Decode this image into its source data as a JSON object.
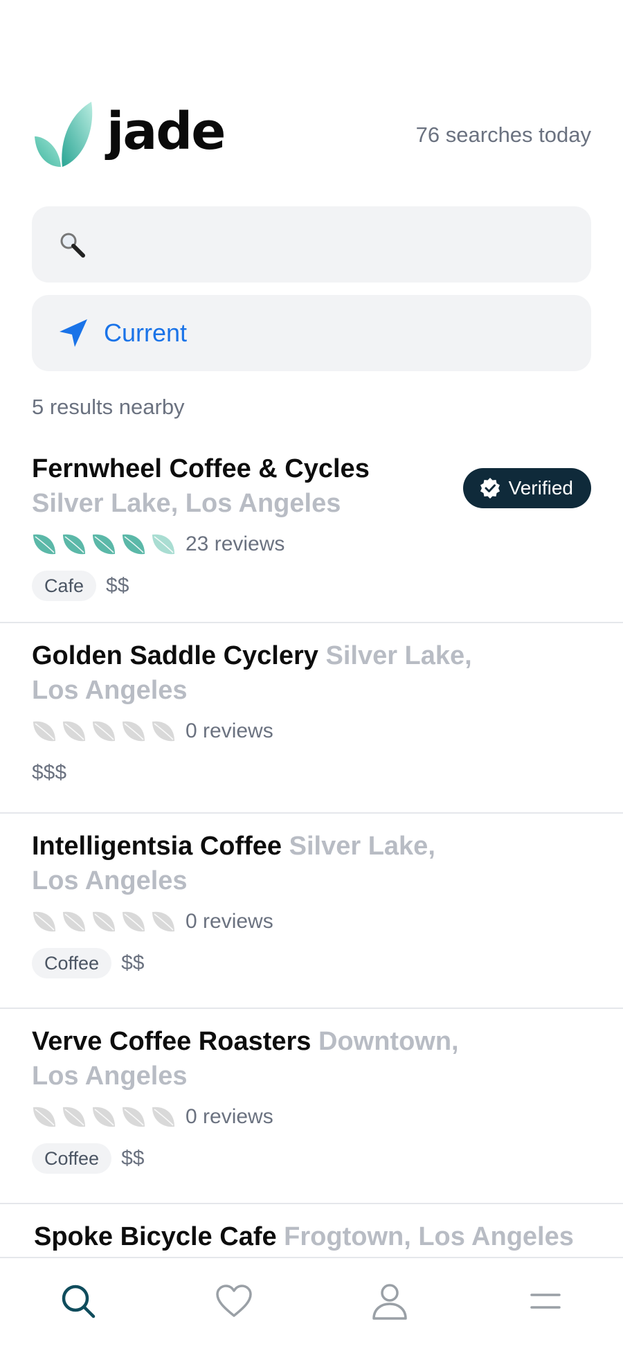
{
  "header": {
    "logo_text": "jade",
    "searches_today": "76 searches today"
  },
  "search": {
    "icon": "search-icon",
    "value": "",
    "placeholder": ""
  },
  "location": {
    "icon": "location-arrow-icon",
    "label": "Current",
    "color": "#1a73e8"
  },
  "results": {
    "count_text": "5 results nearby",
    "items": [
      {
        "name": "Fernwheel Coffee & Cycles",
        "location": "Silver Lake, Los Angeles",
        "rating": 4.5,
        "reviews": "23 reviews",
        "tags": [
          "Cafe"
        ],
        "price": "$$",
        "verified": true,
        "badge_label": "Verified"
      },
      {
        "name": "Golden Saddle Cyclery",
        "location": "Silver Lake, Los Angeles",
        "rating": 0,
        "reviews": "0 reviews",
        "tags": [],
        "price": "$$$",
        "verified": false
      },
      {
        "name": "Intelligentsia Coffee",
        "location": "Silver Lake, Los Angeles",
        "rating": 0,
        "reviews": "0 reviews",
        "tags": [
          "Coffee"
        ],
        "price": "$$",
        "verified": false
      },
      {
        "name": "Verve Coffee Roasters",
        "location": "Downtown, Los Angeles",
        "rating": 0,
        "reviews": "0 reviews",
        "tags": [
          "Coffee"
        ],
        "price": "$$",
        "verified": false
      },
      {
        "name": "Spoke Bicycle Cafe",
        "location": "Frogtown, Los Angeles",
        "rating": 0,
        "reviews": "",
        "tags": [],
        "price": "",
        "verified": false
      }
    ]
  },
  "bottom_nav": {
    "items": [
      {
        "icon": "search-icon",
        "active": true
      },
      {
        "icon": "heart-icon",
        "active": false
      },
      {
        "icon": "profile-icon",
        "active": false
      },
      {
        "icon": "menu-icon",
        "active": false
      }
    ]
  },
  "colors": {
    "leaf_filled": "#5bb8a8",
    "leaf_empty": "#d9d9d9",
    "badge_bg": "#0f2a3a",
    "nav_active": "#0f4c5c",
    "nav_inactive": "#9aa0a6"
  }
}
